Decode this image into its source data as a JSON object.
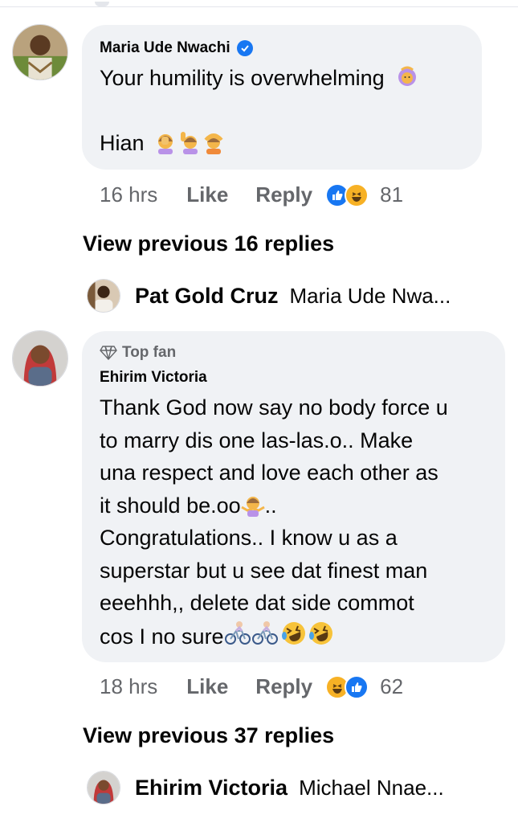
{
  "comments": [
    {
      "author": "Maria Ude Nwachi",
      "verified": true,
      "line1": "Your humility is overwhelming",
      "line2": "Hian",
      "emoji_line1": [
        "person-raising-hands-icon"
      ],
      "emoji_line2": [
        "facepalm-icon",
        "raising-hand-icon",
        "hands-on-head-icon"
      ],
      "time": "16 hrs",
      "like_label": "Like",
      "reply_label": "Reply",
      "reactions": [
        "like-reaction-icon",
        "haha-reaction-icon"
      ],
      "reaction_count": "81",
      "view_previous": "View previous 16 replies",
      "latest_reply": {
        "name": "Pat Gold Cruz",
        "snippet": "Maria Ude Nwa..."
      }
    },
    {
      "badge": "Top fan",
      "author": "Ehirim Victoria",
      "lines": [
        "Thank God now say no body force u",
        "to marry dis one las-las.o.. Make",
        "una respect and love each other as",
        "it should be.oo",
        "Congratulations.. I know u as a",
        "superstar but u see dat finest man",
        "eeehhh,, delete dat side commot",
        "cos I no sure"
      ],
      "line4_suffix": "..",
      "emoji_line4": [
        "shrugging-woman-icon"
      ],
      "emoji_line8": [
        "cyclist-icon",
        "cyclist-icon",
        "rolling-laugh-icon",
        "rolling-laugh-icon"
      ],
      "time": "18 hrs",
      "like_label": "Like",
      "reply_label": "Reply",
      "reactions": [
        "haha-reaction-icon",
        "like-reaction-icon"
      ],
      "reaction_count": "62",
      "view_previous": "View previous 37 replies",
      "latest_reply": {
        "name": "Ehirim Victoria",
        "snippet": "Michael Nnae..."
      }
    }
  ],
  "colors": {
    "bubble": "#f0f2f5",
    "muted_text": "#65676b",
    "like_blue": "#1877f2",
    "haha_yellow": "#f7b125"
  }
}
